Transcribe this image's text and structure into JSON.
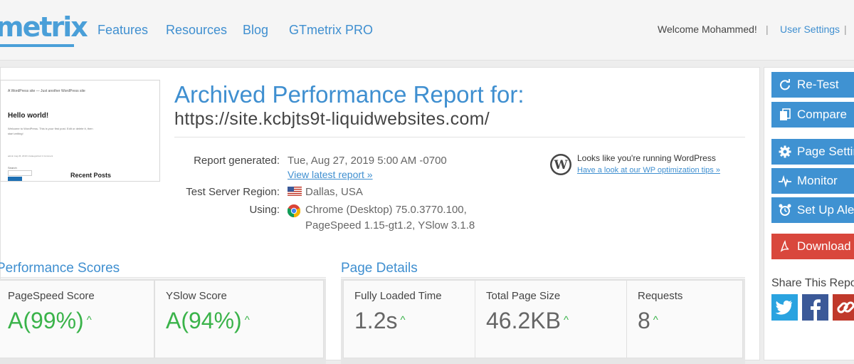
{
  "header": {
    "logo": "metrix",
    "nav": [
      "Features",
      "Resources",
      "Blog",
      "GTmetrix PRO"
    ],
    "welcome": "Welcome Mohammed!",
    "user_settings": "User Settings"
  },
  "report": {
    "title": "Archived Performance Report for:",
    "url": "https://site.kcbjts9t-liquidwebsites.com/",
    "generated_label": "Report generated:",
    "generated_value": "Tue, Aug 27, 2019 5:00 AM -0700",
    "latest_link": "View latest report »",
    "region_label": "Test Server Region:",
    "region_value": "Dallas, USA",
    "using_label": "Using:",
    "using_line1": "Chrome (Desktop) 75.0.3770.100,",
    "using_line2": "PageSpeed 1.15-gt1.2, YSlow 3.1.8"
  },
  "thumbnail": {
    "site_title": "A WordPress site — Just another WordPress site",
    "post_title": "Hello world!",
    "post_text": "Welcome to WordPress. This is your first post. Edit or delete it, then start writing!",
    "meta": "admin   Aug 26, 2019   Uncategorized   1 Comment",
    "search_btn": "Search",
    "recent_posts": "Recent Posts"
  },
  "wordpress": {
    "notice": "Looks like you're running WordPress",
    "link": "Have a look at our WP optimization tips »"
  },
  "performance": {
    "title": "Performance Scores",
    "pagespeed_label": "PageSpeed Score",
    "pagespeed_grade": "A",
    "pagespeed_pct": "(99%)",
    "yslow_label": "YSlow Score",
    "yslow_grade": "A",
    "yslow_pct": "(94%)"
  },
  "details": {
    "title": "Page Details",
    "load_label": "Fully Loaded Time",
    "load_value": "1.2s",
    "size_label": "Total Page Size",
    "size_value": "46.2KB",
    "requests_label": "Requests",
    "requests_value": "8"
  },
  "sidebar": {
    "retest": "Re-Test",
    "compare": "Compare",
    "page_settings": "Page Settings",
    "monitor": "Monitor",
    "setup_alerts": "Set Up Alerts",
    "download": "Download PDF",
    "share_title": "Share This Report"
  },
  "colors": {
    "accent": "#3f8fd0",
    "grade_green": "#3ab34a",
    "pdf_red": "#d9473c",
    "twitter": "#2aa3e0",
    "facebook": "#3b5998",
    "link_icon": "#c0392b"
  }
}
